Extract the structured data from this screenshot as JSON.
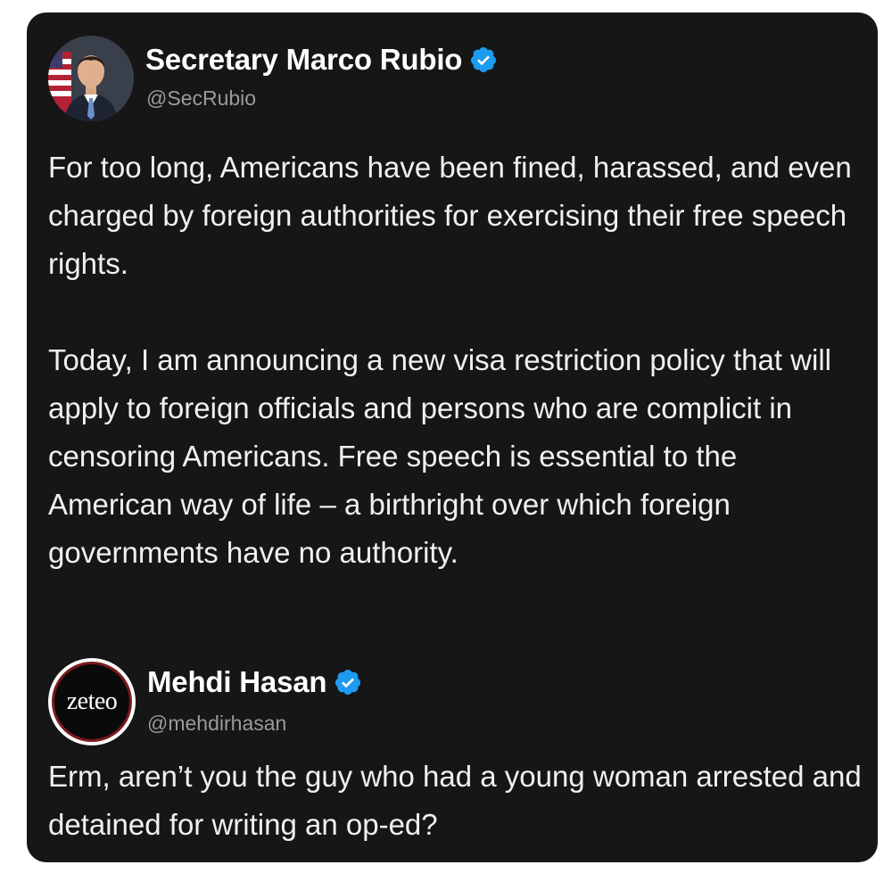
{
  "posts": [
    {
      "display_name": "Secretary Marco Rubio",
      "handle": "@SecRubio",
      "verified": true,
      "avatar_icon": "profile-photo",
      "paragraphs": [
        "For too long, Americans have been fined, harassed, and even charged by foreign authorities for exercising their free speech rights.",
        "Today, I am announcing a new visa restriction policy that will apply to foreign officials and persons who are complicit in censoring Americans. Free speech is essential to the American way of life – a birthright over which foreign governments have no authority."
      ]
    },
    {
      "display_name": "Mehdi Hasan",
      "handle": "@mehdirhasan",
      "verified": true,
      "avatar_text": "zeteo",
      "paragraphs": [
        "Erm, aren’t you the guy who had a young woman arrested and detained for writing an op-ed?"
      ]
    }
  ],
  "colors": {
    "card_background": "#161616",
    "verified_badge": "#1d9bf0",
    "text_primary": "#f0f0f0",
    "text_secondary": "#9a9a9a",
    "zeteo_ring": "#7a1a1f"
  }
}
